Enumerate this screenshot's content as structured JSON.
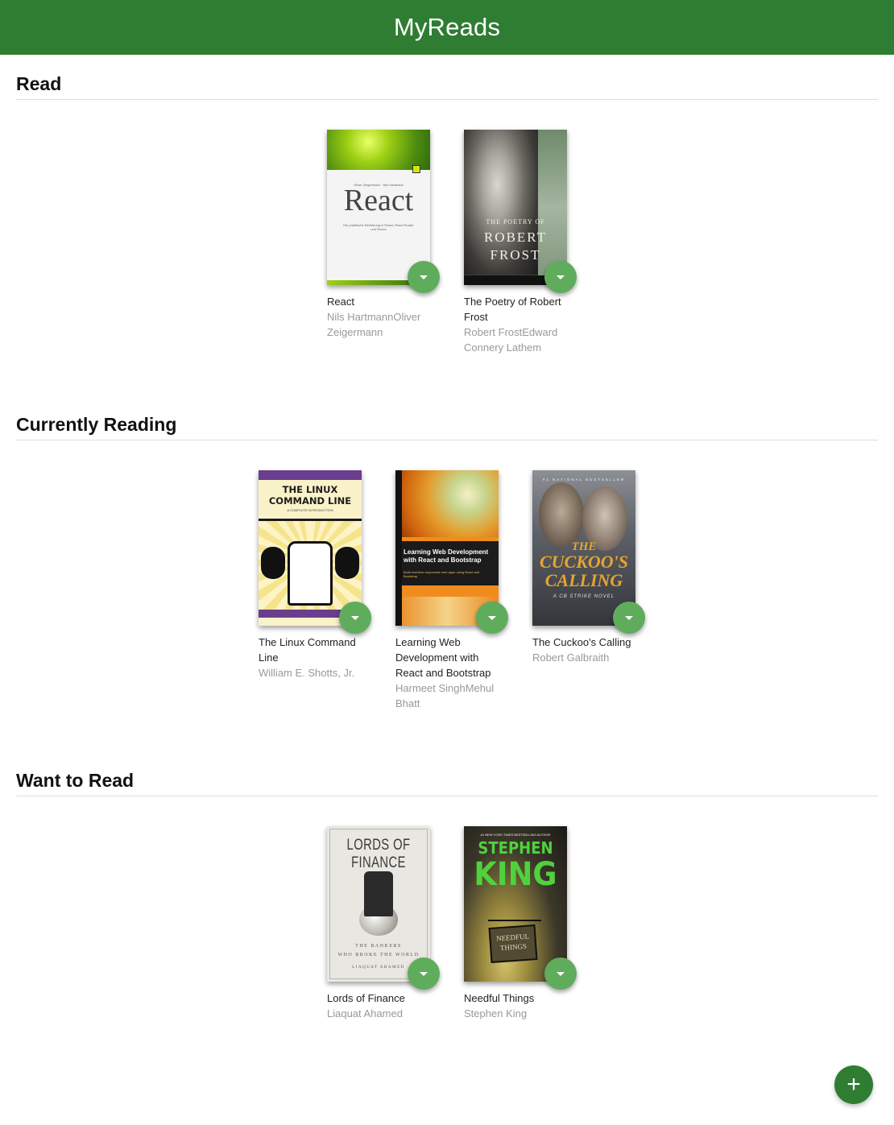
{
  "app": {
    "title": "MyReads"
  },
  "shelves": [
    {
      "title": "Read",
      "books": [
        {
          "title": "React",
          "authors": "Nils HartmannOliver Zeigermann",
          "cover": {
            "by": "Oliver Zeigermann · Nils Hartmann",
            "title": "React",
            "subtitle": "Die praktische Einführung in React, React Router und Redux"
          }
        },
        {
          "title": "The Poetry of Robert Frost",
          "authors": "Robert FrostEdward Connery Lathem",
          "cover": {
            "line1": "THE POETRY OF",
            "line2": "ROBERT",
            "line3": "FROST"
          }
        }
      ]
    },
    {
      "title": "Currently Reading",
      "books": [
        {
          "title": "The Linux Command Line",
          "authors": "William E. Shotts, Jr.",
          "cover": {
            "title": "THE LINUX COMMAND LINE",
            "subtitle": "A COMPLETE INTRODUCTION"
          }
        },
        {
          "title": "Learning Web Development with React and Bootstrap",
          "authors": "Harmeet SinghMehul Bhatt",
          "cover": {
            "title": "Learning Web Development with React and Bootstrap",
            "subtitle": "Build real-time responsive web apps using React and Bootstrap"
          }
        },
        {
          "title": "The Cuckoo's Calling",
          "authors": "Robert Galbraith",
          "cover": {
            "header": "#1 NATIONAL BESTSELLER",
            "line1": "THE",
            "line2": "CUCKOO'S",
            "line3": "CALLING",
            "subtitle": "A CB STRIKE NOVEL"
          }
        }
      ]
    },
    {
      "title": "Want to Read",
      "books": [
        {
          "title": "Lords of Finance",
          "authors": "Liaquat Ahamed",
          "cover": {
            "title": "LORDS OF FINANCE",
            "line1": "THE BANKERS",
            "line2": "WHO BROKE THE WORLD",
            "author": "LIAQUAT AHAMED"
          }
        },
        {
          "title": "Needful Things",
          "authors": "Stephen King",
          "cover": {
            "tag": "#1 NEW YORK TIMES BESTSELLING AUTHOR",
            "line1": "STEPHEN",
            "line2": "KING",
            "sign1": "NEEDFUL",
            "sign2": "THINGS"
          }
        }
      ]
    }
  ],
  "fab": {
    "label": "+",
    "icon": "add-icon"
  },
  "colors": {
    "header": "#2e7d32",
    "changer": "#60ac5d",
    "fab": "#2e7d32",
    "author": "#999999"
  }
}
